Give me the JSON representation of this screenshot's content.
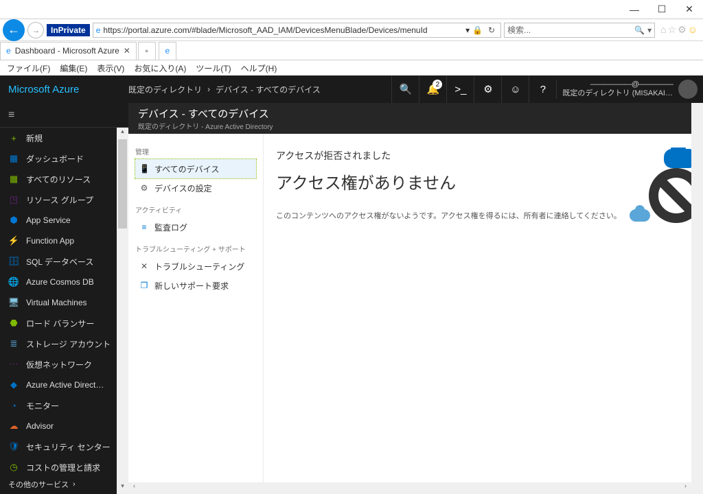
{
  "winCtrl": {
    "min": "—",
    "max": "☐",
    "close": "✕"
  },
  "ie": {
    "inprivate": "InPrivate",
    "url": "https://portal.azure.com/#blade/Microsoft_AAD_IAM/DevicesMenuBlade/Devices/menuId",
    "urlDropArrow": "▾",
    "searchPlaceholder": "検索...",
    "searchDrop": "▾"
  },
  "tab": {
    "title": "Dashboard - Microsoft Azure",
    "close": "✕"
  },
  "menu": [
    "ファイル(F)",
    "編集(E)",
    "表示(V)",
    "お気に入り(A)",
    "ツール(T)",
    "ヘルプ(H)"
  ],
  "brand": "Microsoft Azure",
  "breadcrumb": [
    "既定のディレクトリ",
    "›",
    "デバイス - すべてのデバイス"
  ],
  "notifCount": "2",
  "user": {
    "line1": "――――――@―――――",
    "line2": "既定のディレクトリ (MISAKAI…"
  },
  "fav": {
    "new": "新規",
    "items": [
      {
        "label": "ダッシュボード",
        "ico": "▦",
        "color": "#0078d4"
      },
      {
        "label": "すべてのリソース",
        "ico": "▦",
        "color": "#7fba00"
      },
      {
        "label": "リソース グループ",
        "ico": "◳",
        "color": "#68217a"
      },
      {
        "label": "App Service",
        "ico": "⬢",
        "color": "#0078d4"
      },
      {
        "label": "Function App",
        "ico": "⚡",
        "color": "#f2c811"
      },
      {
        "label": "SQL データベース",
        "ico": "🗄",
        "color": "#0072c6"
      },
      {
        "label": "Azure Cosmos DB",
        "ico": "🌐",
        "color": "#0072c6"
      },
      {
        "label": "Virtual Machines",
        "ico": "🖥",
        "color": "#86c7e3"
      },
      {
        "label": "ロード バランサー",
        "ico": "⬣",
        "color": "#7fba00"
      },
      {
        "label": "ストレージ アカウント",
        "ico": "≣",
        "color": "#5aa6d8"
      },
      {
        "label": "仮想ネットワーク",
        "ico": "⋯",
        "color": "#68217a"
      },
      {
        "label": "Azure Active Direct…",
        "ico": "◆",
        "color": "#0072c6"
      },
      {
        "label": "モニター",
        "ico": "◔",
        "color": "#0072c6"
      },
      {
        "label": "Advisor",
        "ico": "☁",
        "color": "#e06228"
      },
      {
        "label": "セキュリティ センター",
        "ico": "🛡",
        "color": "#0072c6"
      },
      {
        "label": "コストの管理と請求",
        "ico": "◷",
        "color": "#7fba00"
      }
    ],
    "other": "その他のサービス",
    "arrow": "›"
  },
  "blade": {
    "title": "デバイス - すべてのデバイス",
    "subtitle": "既定のディレクトリ - Azure Active Directory"
  },
  "menuBlade": {
    "sect1": "管理",
    "items1": [
      {
        "label": "すべてのデバイス",
        "ico": "📱"
      },
      {
        "label": "デバイスの設定",
        "ico": "⚙"
      }
    ],
    "sect2": "アクティビティ",
    "items2": [
      {
        "label": "監査ログ",
        "ico": "≡"
      }
    ],
    "sect3": "トラブルシューティング + サポート",
    "items3": [
      {
        "label": "トラブルシューティング",
        "ico": "✕"
      },
      {
        "label": "新しいサポート要求",
        "ico": "❐"
      }
    ]
  },
  "content": {
    "head": "アクセスが拒否されました",
    "big": "アクセス権がありません",
    "msg": "このコンテンツへのアクセス権がないようです。アクセス権を得るには、所有者に連絡してください。"
  },
  "scroll": {
    "left": "‹",
    "right": "›",
    "up": "▴",
    "down": "▾"
  }
}
